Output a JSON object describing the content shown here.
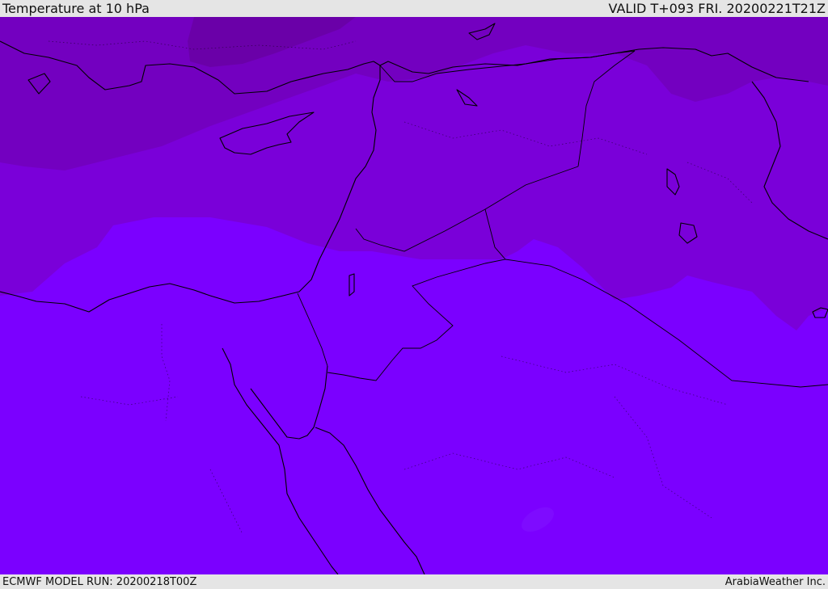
{
  "header": {
    "title": "Temperature at 10 hPa",
    "valid": "VALID T+093 FRI. 20200221T21Z"
  },
  "footer": {
    "model_run": "ECMWF MODEL RUN: 20200218T00Z",
    "credit": "ArabiaWeather Inc."
  },
  "colors": {
    "band_coldest": "#6a00a8",
    "band_cold": "#7300c0",
    "band_mid": "#7a00d9",
    "band_warm": "#7b00ff",
    "cell": "#8010ff",
    "coast": "#000000"
  }
}
